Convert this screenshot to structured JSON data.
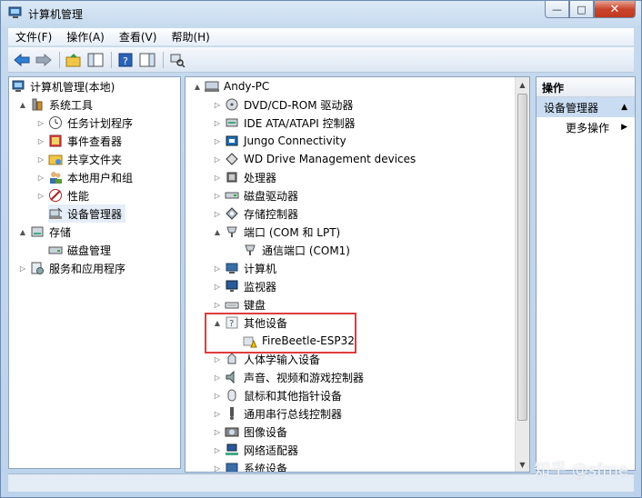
{
  "window": {
    "title": "计算机管理",
    "minimize": "—",
    "maximize": "□",
    "close": "✕"
  },
  "menu": [
    "文件(F)",
    "操作(A)",
    "查看(V)",
    "帮助(H)"
  ],
  "left_tree": [
    {
      "label": "计算机管理(本地)",
      "level": 0,
      "expander": "",
      "icon": "computer-management-icon"
    },
    {
      "label": "系统工具",
      "level": 1,
      "expander": "▲",
      "icon": "tools-icon"
    },
    {
      "label": "任务计划程序",
      "level": 2,
      "expander": "▷",
      "icon": "clock-icon"
    },
    {
      "label": "事件查看器",
      "level": 2,
      "expander": "▷",
      "icon": "event-viewer-icon"
    },
    {
      "label": "共享文件夹",
      "level": 2,
      "expander": "▷",
      "icon": "shared-folder-icon"
    },
    {
      "label": "本地用户和组",
      "level": 2,
      "expander": "▷",
      "icon": "users-icon"
    },
    {
      "label": "性能",
      "level": 2,
      "expander": "▷",
      "icon": "performance-icon"
    },
    {
      "label": "设备管理器",
      "level": 2,
      "expander": "",
      "icon": "device-manager-icon",
      "selected": true
    },
    {
      "label": "存储",
      "level": 0,
      "expander": "▲",
      "icon": "storage-icon"
    },
    {
      "label": "磁盘管理",
      "level": 1,
      "expander": "",
      "icon": "disk-icon"
    },
    {
      "label": "服务和应用程序",
      "level": 0,
      "expander": "▷",
      "icon": "services-icon"
    }
  ],
  "device_tree": {
    "root": "Andy-PC",
    "items": [
      {
        "label": "DVD/CD-ROM 驱动器",
        "level": 1,
        "expander": "▷",
        "icon": "dvd-icon"
      },
      {
        "label": "IDE ATA/ATAPI 控制器",
        "level": 1,
        "expander": "▷",
        "icon": "ide-icon"
      },
      {
        "label": "Jungo Connectivity",
        "level": 1,
        "expander": "▷",
        "icon": "jungo-icon"
      },
      {
        "label": "WD Drive Management devices",
        "level": 1,
        "expander": "▷",
        "icon": "wd-icon"
      },
      {
        "label": "处理器",
        "level": 1,
        "expander": "▷",
        "icon": "processor-icon"
      },
      {
        "label": "磁盘驱动器",
        "level": 1,
        "expander": "▷",
        "icon": "disk-drive-icon"
      },
      {
        "label": "存储控制器",
        "level": 1,
        "expander": "▷",
        "icon": "storage-controller-icon"
      },
      {
        "label": "端口 (COM 和 LPT)",
        "level": 1,
        "expander": "▲",
        "icon": "port-icon"
      },
      {
        "label": "通信端口 (COM1)",
        "level": 2,
        "expander": "",
        "icon": "port-icon"
      },
      {
        "label": "计算机",
        "level": 1,
        "expander": "▷",
        "icon": "computer-icon"
      },
      {
        "label": "监视器",
        "level": 1,
        "expander": "▷",
        "icon": "monitor-icon"
      },
      {
        "label": "键盘",
        "level": 1,
        "expander": "▷",
        "icon": "keyboard-icon"
      },
      {
        "label": "其他设备",
        "level": 1,
        "expander": "▲",
        "icon": "unknown-device-icon"
      },
      {
        "label": "FireBeetle-ESP32",
        "level": 2,
        "expander": "",
        "icon": "warning-device-icon"
      },
      {
        "label": "人体学输入设备",
        "level": 1,
        "expander": "▷",
        "icon": "hid-icon"
      },
      {
        "label": "声音、视频和游戏控制器",
        "level": 1,
        "expander": "▷",
        "icon": "sound-icon"
      },
      {
        "label": "鼠标和其他指针设备",
        "level": 1,
        "expander": "▷",
        "icon": "mouse-icon"
      },
      {
        "label": "通用串行总线控制器",
        "level": 1,
        "expander": "▷",
        "icon": "usb-icon"
      },
      {
        "label": "图像设备",
        "level": 1,
        "expander": "▷",
        "icon": "camera-icon"
      },
      {
        "label": "网络适配器",
        "level": 1,
        "expander": "▷",
        "icon": "network-icon"
      },
      {
        "label": "系统设备",
        "level": 1,
        "expander": "▷",
        "icon": "system-icon"
      }
    ]
  },
  "actions": {
    "header": "操作",
    "group": "设备管理器",
    "group_arrow": "▲",
    "more": "更多操作",
    "more_arrow": "▶"
  },
  "watermark": "知乎 @sfme"
}
